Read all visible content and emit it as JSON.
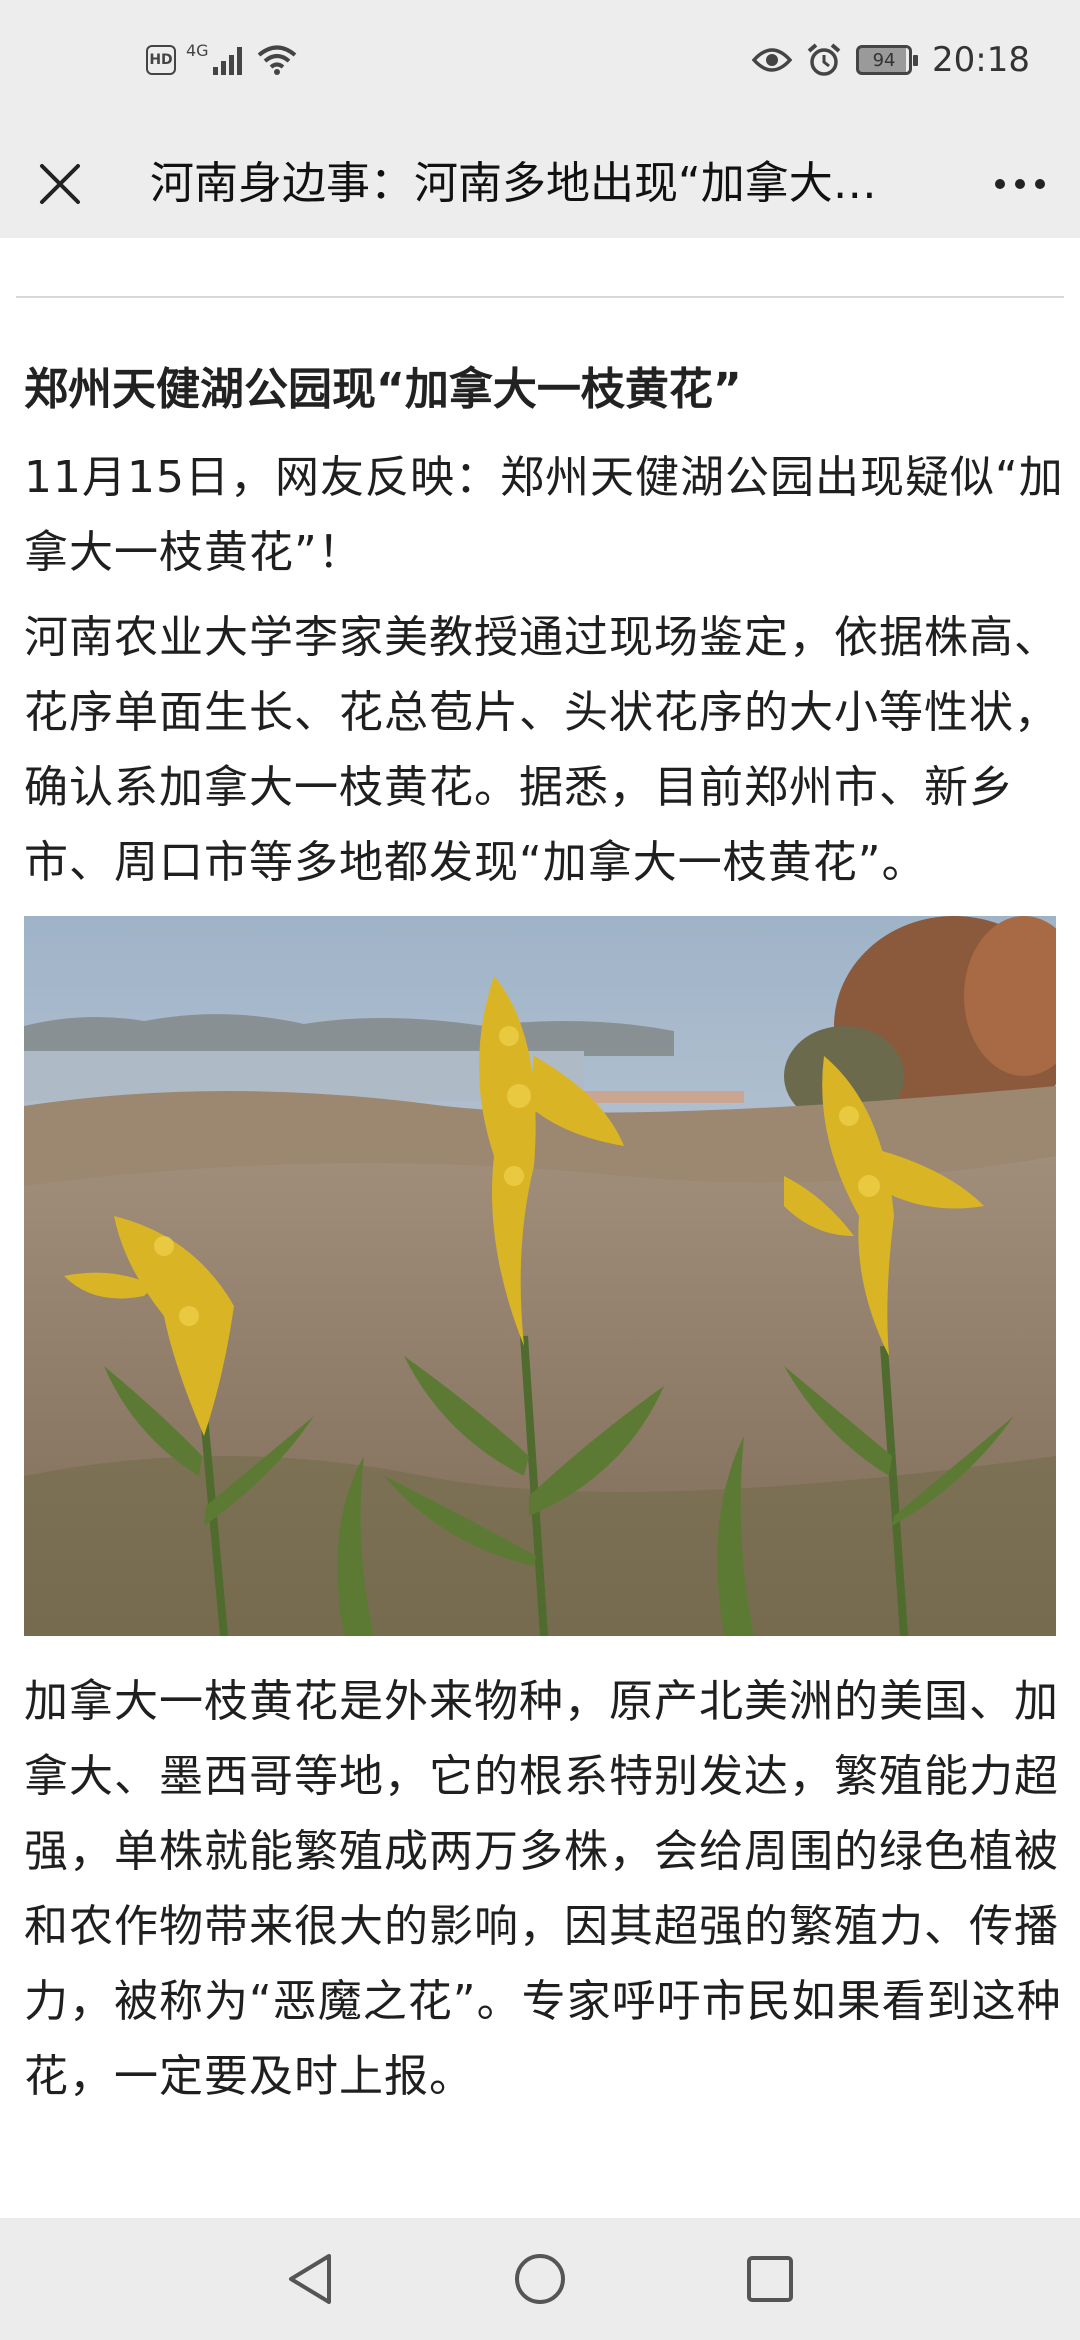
{
  "status_bar": {
    "network_label": "4G",
    "hd_label": "HD",
    "battery_level": "94",
    "time": "20:18"
  },
  "header": {
    "title": "河南身边事：河南多地出现“加拿大一枝黄花”"
  },
  "article": {
    "headline": "郑州天健湖公园现“加拿大一枝黄花”",
    "paragraphs": [
      "11月15日，网友反映：郑州天健湖公园出现疑似“加拿大一枝黄花”！",
      "河南农业大学李家美教授通过现场鉴定，依据株高、花序单面生长、花总苞片、头状花序的大小等性状，确认系加拿大一枝黄花。据悉，目前郑州市、新乡市、周口市等多地都发现“加拿大一枝黄花”。",
      "加拿大一枝黄花是外来物种，原产北美洲的美国、加拿大、墨西哥等地，它的根系特别发达，繁殖能力超强，单株就能繁殖成两万多株，会给周围的绿色植被和农作物带来很大的影响，因其超强的繁殖力、传播力，被称为“恶魔之花”。专家呼吁市民如果看到这种花，一定要及时上报。"
    ]
  },
  "icons": {
    "close": "close-icon",
    "more": "more-icon",
    "back": "back-triangle-icon",
    "home": "home-circle-icon",
    "recents": "recents-square-icon"
  }
}
